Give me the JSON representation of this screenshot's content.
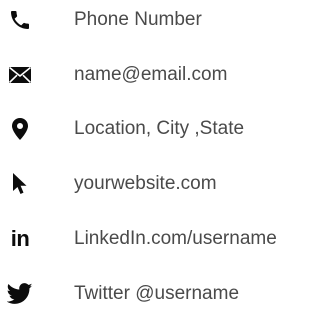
{
  "contacts": [
    {
      "icon": "phone-icon",
      "text": "Phone Number"
    },
    {
      "icon": "envelope-icon",
      "text": "name@email.com"
    },
    {
      "icon": "location-pin-icon",
      "text": "Location, City ,State"
    },
    {
      "icon": "cursor-arrow-icon",
      "text": "yourwebsite.com"
    },
    {
      "icon": "linkedin-icon",
      "glyph": "in",
      "text": "LinkedIn.com/username"
    },
    {
      "icon": "twitter-icon",
      "text": "Twitter @username"
    }
  ],
  "colors": {
    "icon": "#0c0c0c",
    "text": "#4a4a4a",
    "background": "#ffffff"
  }
}
